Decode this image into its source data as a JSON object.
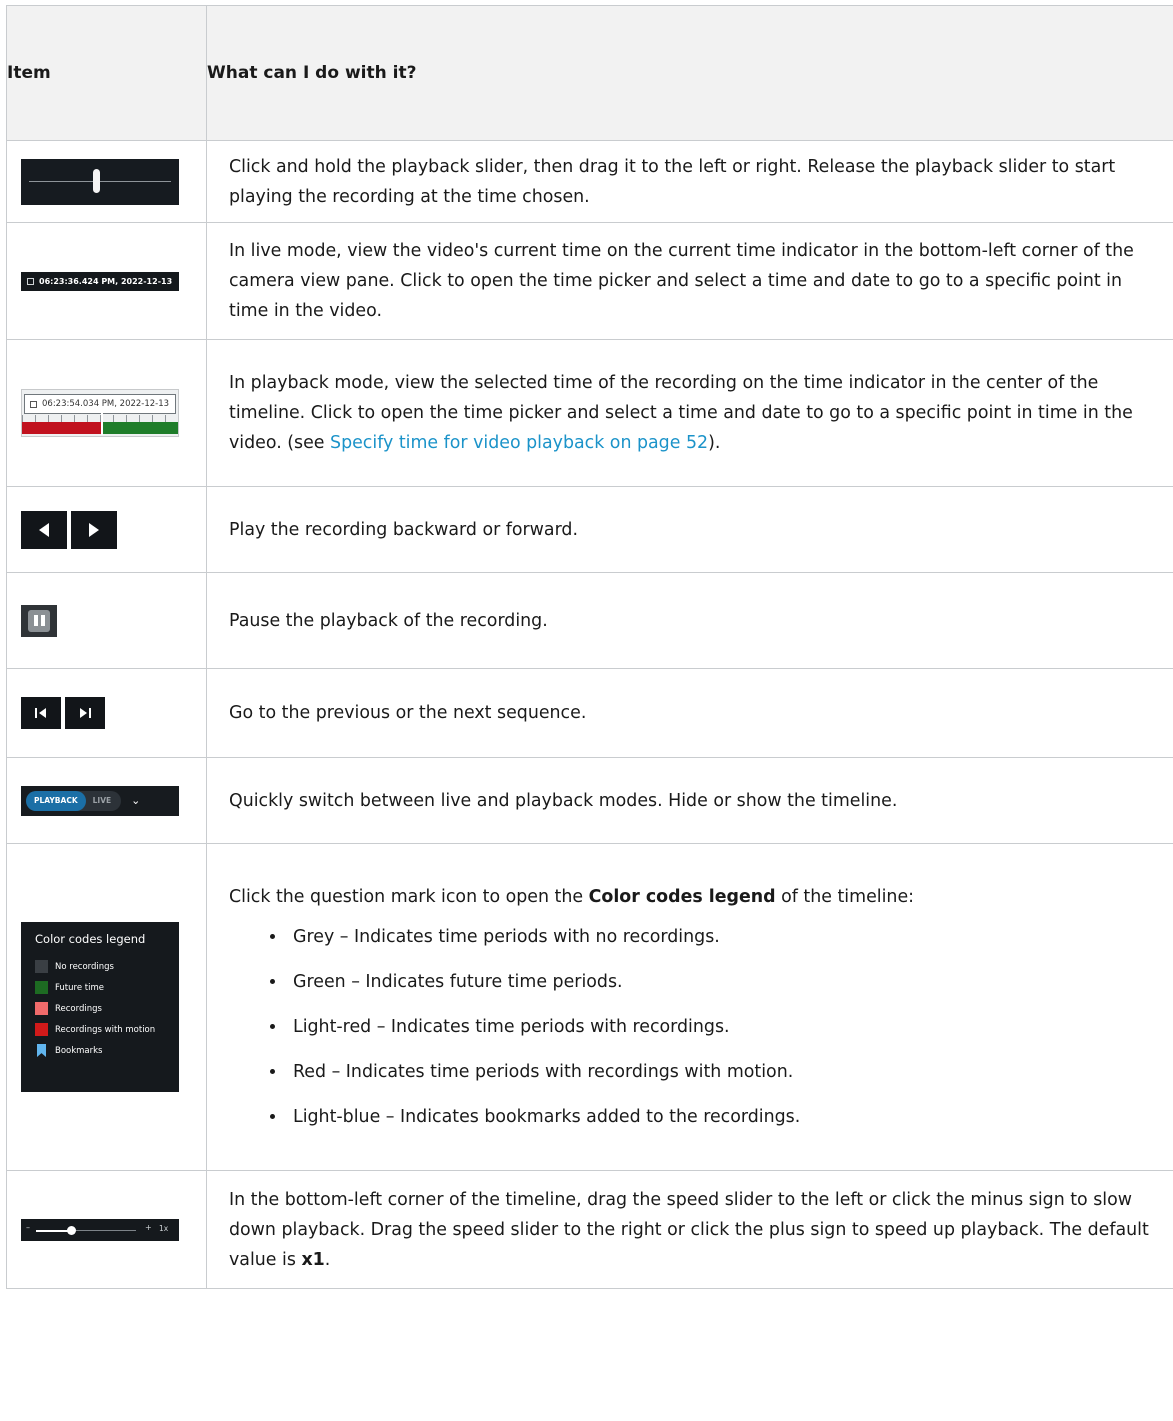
{
  "header": {
    "col_item": "Item",
    "col_what": "What can I do with it?"
  },
  "rows": {
    "slider": {
      "text": "Click and hold the playback slider, then drag it to the left or right. Release the playback slider to start playing the recording at the time chosen."
    },
    "live_time": {
      "img_text": "06:23:36.424 PM, 2022-12-13",
      "text": "In live mode, view the video's current time on the current time indicator in the bottom-left corner of the camera view pane. Click to open the time picker and select a time and date to go to a specific point in time in the video."
    },
    "playback_time": {
      "img_text": "06:23:54.034 PM, 2022-12-13",
      "text_before": "In playback mode, view the selected time of the recording on the time indicator in the center of the timeline. Click to open the time picker and select a time and date to go to a specific point in time in the video. (see ",
      "link": "Specify time for video playback on page 52",
      "text_after": ")."
    },
    "play_dir": {
      "text": "Play the recording backward or forward."
    },
    "pause": {
      "text": "Pause the playback of the recording."
    },
    "sequence": {
      "text": "Go to the previous or the next sequence."
    },
    "mode": {
      "img_on": "PLAYBACK",
      "img_off": "LIVE",
      "text": "Quickly switch between live and playback modes. Hide or show the timeline."
    },
    "legend": {
      "img_title": "Color codes legend",
      "img_items": [
        {
          "label": "No recordings",
          "color": "#3a3f44"
        },
        {
          "label": "Future time",
          "color": "#1d6b22"
        },
        {
          "label": "Recordings",
          "color": "#f06b6b"
        },
        {
          "label": "Recordings with motion",
          "color": "#d11a1a"
        },
        {
          "label": "Bookmarks",
          "color": "#61b5ee"
        }
      ],
      "text_before": "Click the question mark icon to open the ",
      "text_bold": "Color codes legend",
      "text_after": " of the timeline:",
      "bullets": [
        "Grey – Indicates time periods with no recordings.",
        "Green – Indicates future time periods.",
        "Light-red – Indicates time periods with recordings.",
        "Red – Indicates time periods with recordings with motion.",
        "Light-blue – Indicates bookmarks added to the recordings."
      ]
    },
    "speed": {
      "img_minus": "–",
      "img_plus": "+",
      "img_value": "1x",
      "text_before": "In the bottom-left corner of the timeline, drag the speed slider to the left or click the minus sign to slow down playback. Drag the speed slider to the right or click the plus sign to speed up playback. The default value is ",
      "text_bold": "x1",
      "text_after": "."
    }
  }
}
